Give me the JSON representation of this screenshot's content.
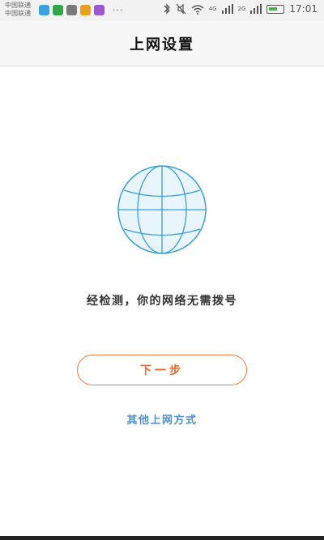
{
  "status_bar": {
    "carrier_line1": "中国联通",
    "carrier_line2": "中国联通",
    "more": "···",
    "network_badge_1": "4G",
    "network_badge_2": "2G",
    "time": "17:01",
    "icons": [
      "bluetooth-icon",
      "mute-icon",
      "wifi-icon",
      "signal-icon",
      "battery-icon"
    ],
    "notification_colors": [
      "#3aa0e0",
      "#2ea84a",
      "#7a7a7a",
      "#e8a21a",
      "#9b59d0"
    ]
  },
  "header": {
    "title": "上网设置"
  },
  "main": {
    "globe_icon": "globe-icon",
    "message": "经检测，你的网络无需拨号",
    "next_button": "下一步",
    "other_link": "其他上网方式"
  },
  "colors": {
    "accent_orange": "#ef6a26",
    "link_blue": "#4a8fcf",
    "globe_stroke": "#3a9fd6",
    "globe_fill": "#e8f5fc"
  }
}
